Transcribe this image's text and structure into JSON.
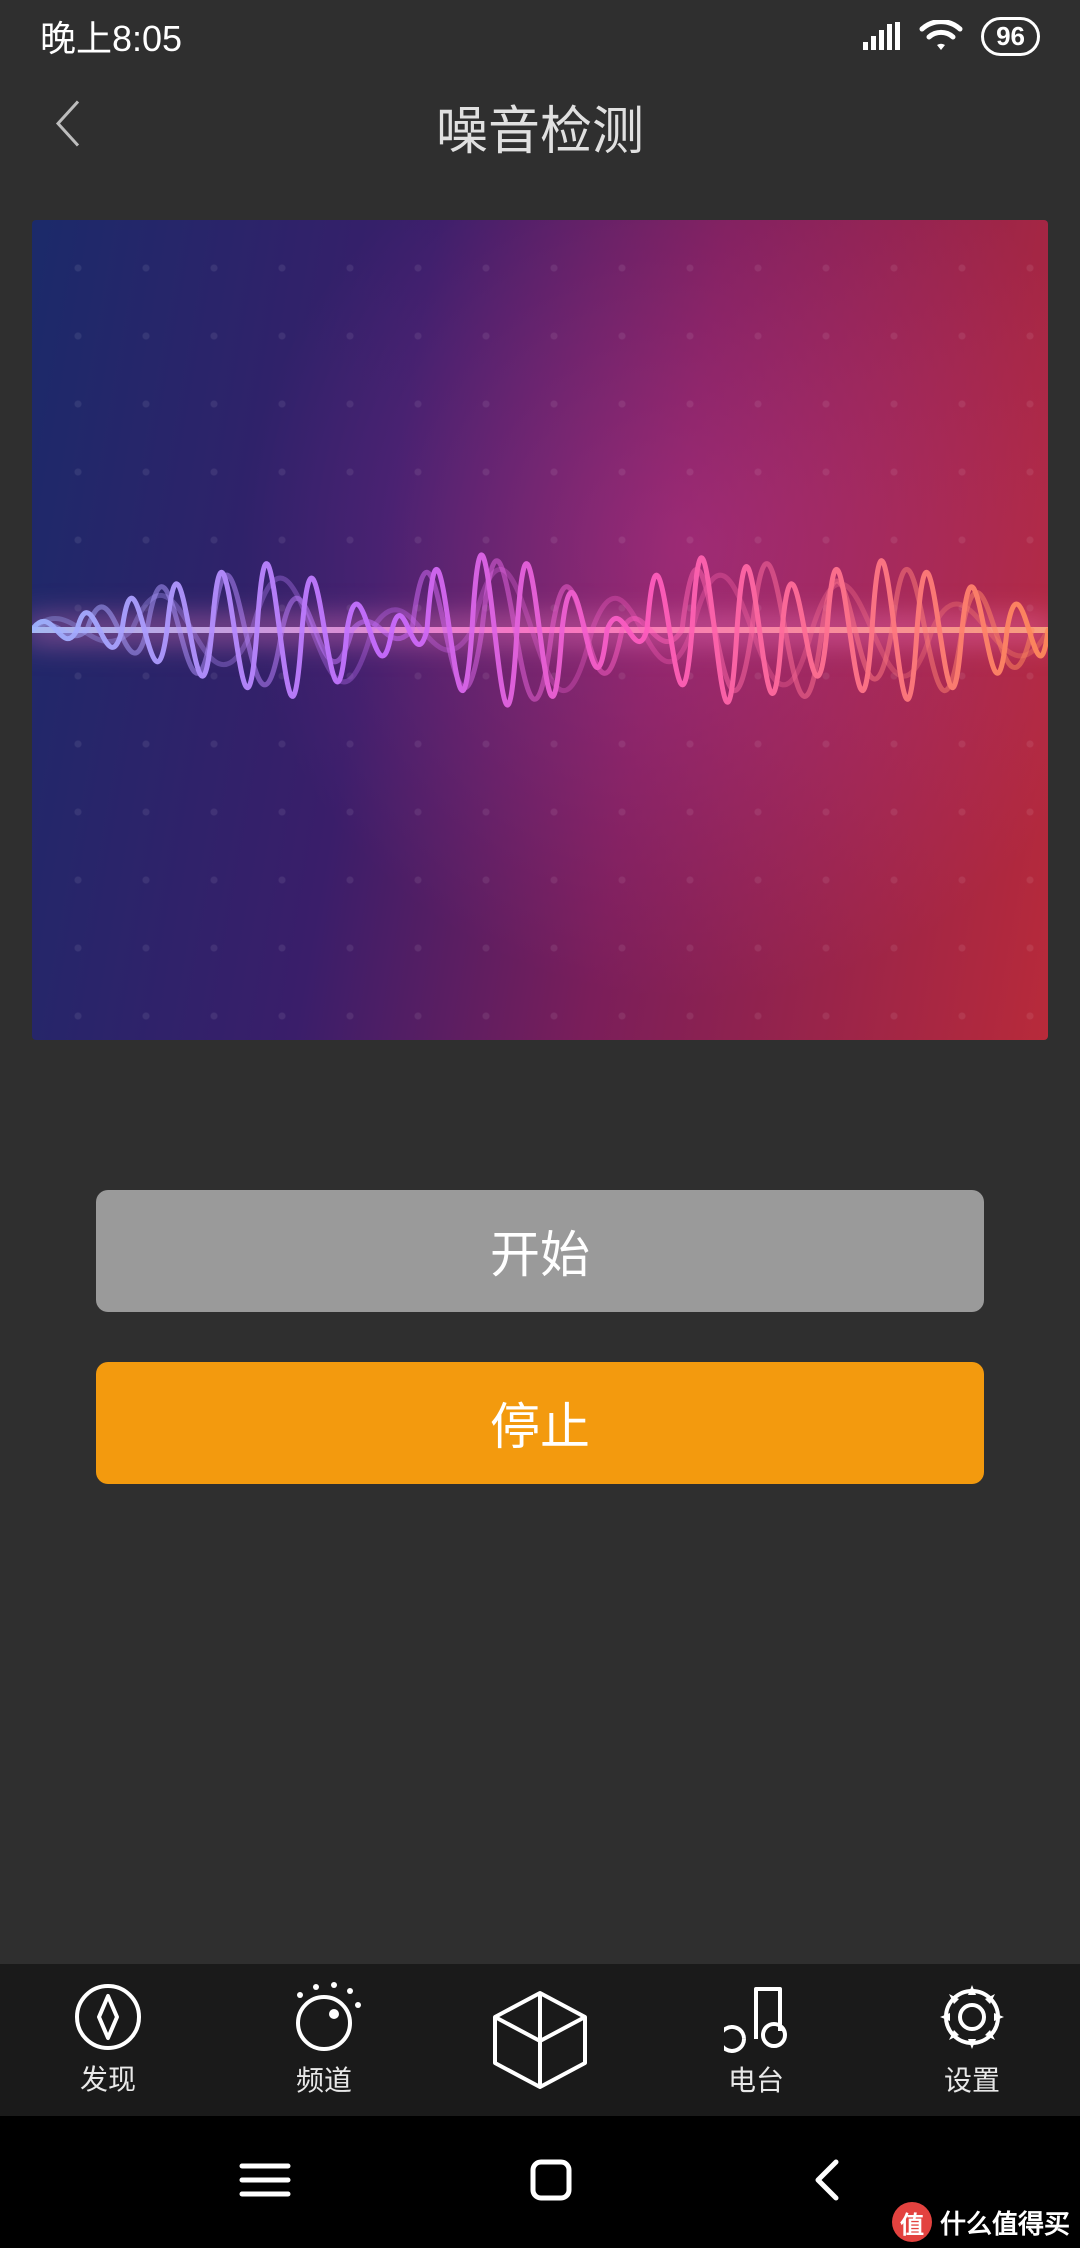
{
  "status_bar": {
    "time": "晚上8:05",
    "battery": "96"
  },
  "header": {
    "title": "噪音检测"
  },
  "buttons": {
    "start": "开始",
    "stop": "停止"
  },
  "tabs": {
    "discover": "发现",
    "channel": "频道",
    "center": "",
    "radio": "电台",
    "settings": "设置"
  },
  "watermark": {
    "badge": "值",
    "text": "什么值得买"
  }
}
